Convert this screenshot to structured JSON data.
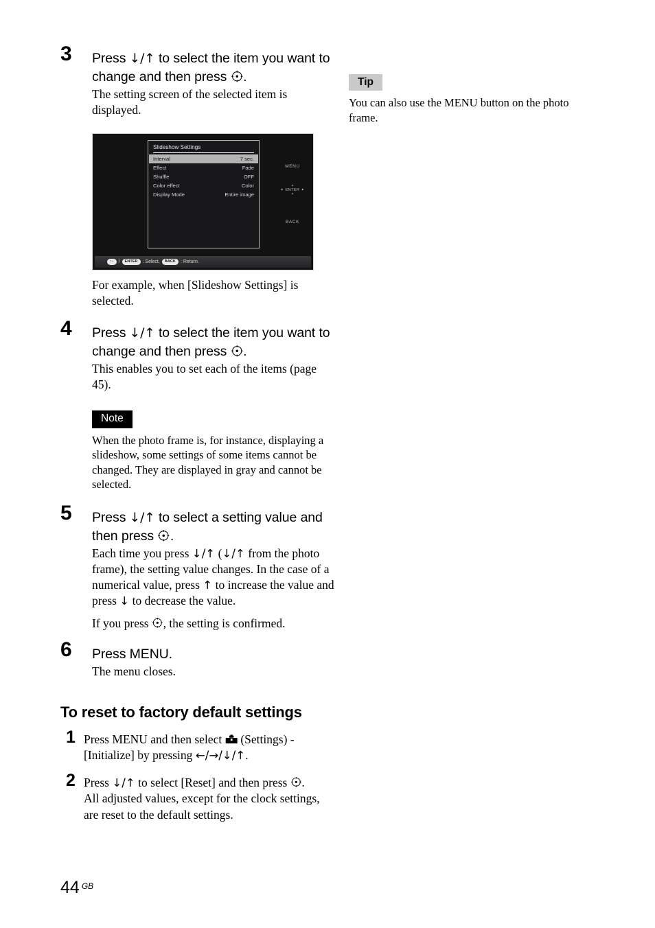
{
  "steps": {
    "step3": {
      "number": "3",
      "lead_pre": "Press ",
      "lead_mid": " to select the item you want to change and then press ",
      "lead_post": ".",
      "desc": "The setting screen of the selected item is displayed."
    },
    "step4": {
      "number": "4",
      "lead_pre": "Press ",
      "lead_mid": " to select the item you want to change and then press ",
      "lead_post": ".",
      "desc": "This enables you to set each of the items (page 45)."
    },
    "step5": {
      "number": "5",
      "lead_pre": "Press ",
      "lead_mid": " to select a setting value and then press ",
      "lead_post": ".",
      "desc_a_1": "Each time you press ",
      "desc_a_2": " (",
      "desc_a_3": " from the photo frame), the setting value changes. In the case of a numerical value, press ",
      "desc_a_4": " to increase the value and press ",
      "desc_a_5": " to decrease the value.",
      "desc_b_1": "If you press ",
      "desc_b_2": ", the setting is confirmed."
    },
    "step6": {
      "number": "6",
      "lead": "Press MENU.",
      "desc": "The menu closes."
    }
  },
  "device_screenshot": {
    "caption": "For example, when [Slideshow Settings] is selected.",
    "panel_title": "Slideshow Settings",
    "rows": [
      {
        "label": "Interval",
        "value": "7 sec.",
        "selected": true
      },
      {
        "label": "Effect",
        "value": "Fade",
        "selected": false
      },
      {
        "label": "Shuffle",
        "value": "OFF",
        "selected": false
      },
      {
        "label": "Color effect",
        "value": "Color",
        "selected": false
      },
      {
        "label": "Display Mode",
        "value": "Entire image",
        "selected": false
      }
    ],
    "side_controls": {
      "menu": "MENU",
      "enter": "ENTER",
      "back": "BACK"
    },
    "status_bar": {
      "dpad_pill": "↑↓",
      "separator": "/",
      "enter_pill": "ENTER",
      "select_text": ": Select,",
      "back_pill": "BACK",
      "return_text": ": Return."
    }
  },
  "note": {
    "badge": "Note",
    "text": "When the photo frame is, for instance, displaying a slideshow, some settings of some items cannot be changed. They are displayed in gray and cannot be selected."
  },
  "tip": {
    "badge": "Tip",
    "text": "You can also use the MENU button on the photo frame."
  },
  "reset_section": {
    "heading": "To reset to factory default settings",
    "step1": {
      "number": "1",
      "text_a": "Press MENU and then select ",
      "text_b": " (Settings) - [Initialize] by pressing ",
      "text_c": "."
    },
    "step2": {
      "number": "2",
      "text_a": "Press ",
      "text_b": " to select [Reset] and then press ",
      "text_c": ".",
      "desc": "All adjusted values, except for the clock settings, are reset to the default settings."
    }
  },
  "glyphs": {
    "down_up": "↓/↑",
    "down": "↓",
    "up": "↑",
    "four_way": "←/→/↓/↑"
  },
  "footer": {
    "page_number": "44",
    "region": "GB"
  },
  "colors": {
    "tip_badge_bg": "#c9c9c9",
    "note_badge_bg": "#000000",
    "screen_bg": "#121212",
    "selected_row_bg": "#b4b4b4"
  }
}
